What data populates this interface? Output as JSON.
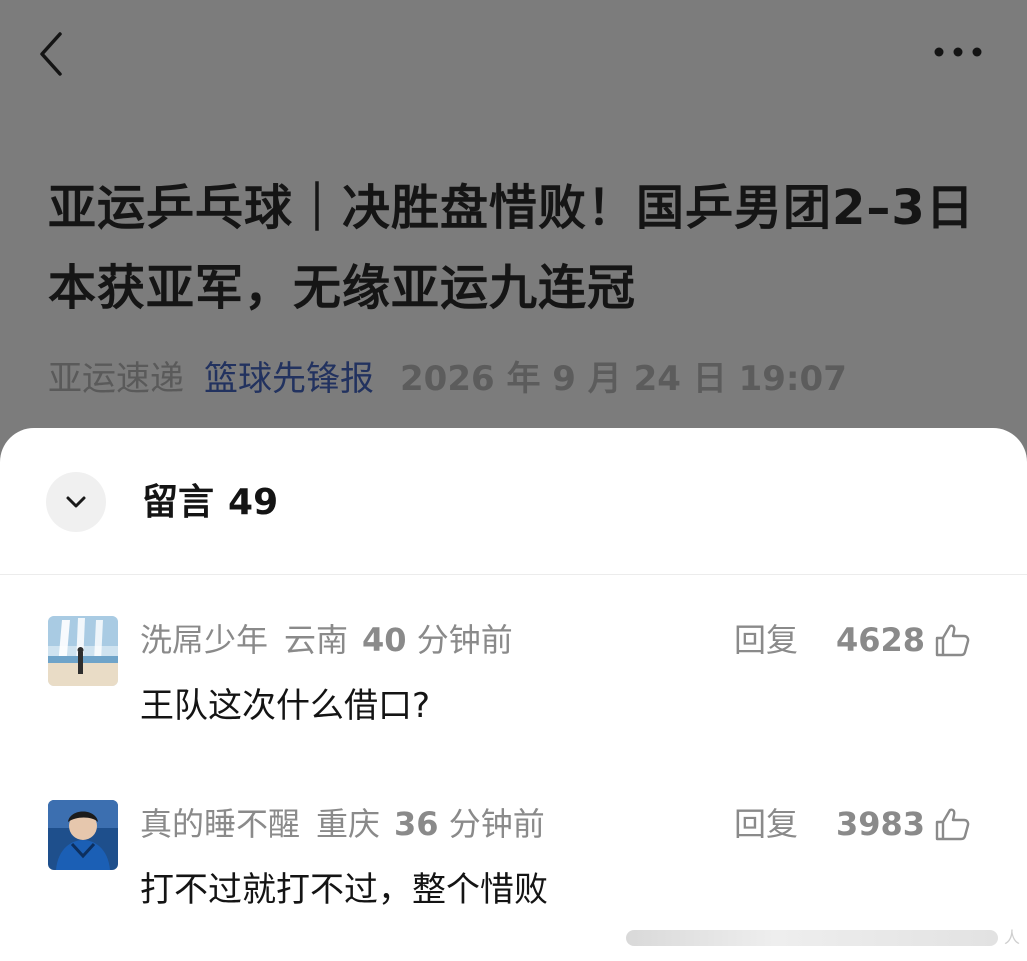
{
  "article": {
    "title": "亚运乒乓球｜决胜盘惜败！国乒男团2–3日本获亚军，无缘亚运九连冠",
    "collection": "亚运速递",
    "account": "篮球先锋报",
    "datetime": "2026 年 9 月 24 日 19:07"
  },
  "comments_panel": {
    "title": "留言",
    "count": "49"
  },
  "comments": [
    {
      "nickname": "洗屌少年",
      "location": "云南",
      "time_num": "40",
      "time_unit": "分钟前",
      "reply_label": "回复",
      "likes": "4628",
      "text": "王队这次什么借口?"
    },
    {
      "nickname": "真的睡不醒",
      "location": "重庆",
      "time_num": "36",
      "time_unit": "分钟前",
      "reply_label": "回复",
      "likes": "3983",
      "text": "打不过就打不过，整个惜败"
    }
  ],
  "watermark": {
    "text": "人"
  },
  "colors": {
    "overlay": "#7c7c7c",
    "title_text": "#151515",
    "account_link": "#22325f",
    "meta_grey": "#8a8a8a",
    "sheet_bg": "#ffffff"
  },
  "icons": [
    "back-arrow-icon",
    "more-dots-icon",
    "chevron-down-icon",
    "thumbs-up-icon"
  ]
}
